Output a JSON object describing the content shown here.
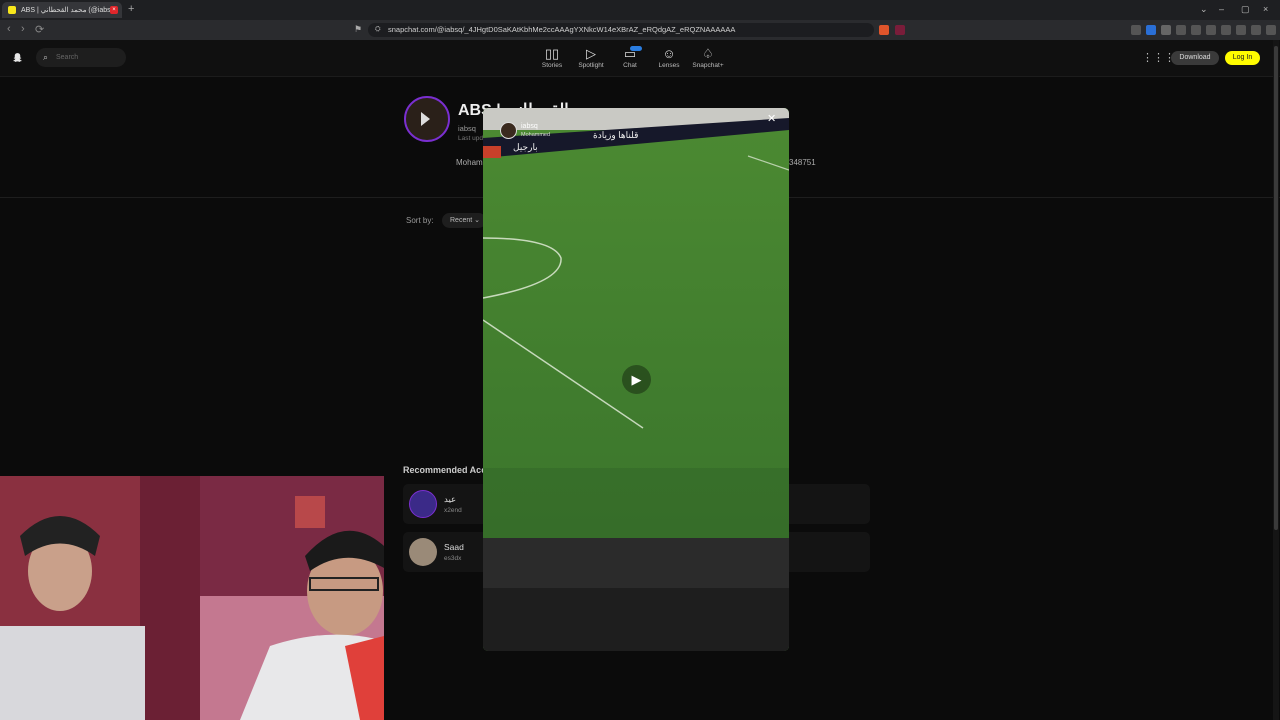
{
  "browser": {
    "tab_title": "ABS | محمد القحطاني (@iabsq",
    "tab_close": "×",
    "new_tab": "+",
    "back": "‹",
    "forward": "›",
    "reload": "⟳",
    "url": "snapchat.com/@iabsq/_4JHgtD0SaKAtKbhMe2ccAAAgYXNkcW14eXBrAZ_eRQdgAZ_eRQZNAAAAAA",
    "minimize": "–",
    "maximize": "▢",
    "close": "×",
    "more": "⌄"
  },
  "snap": {
    "search_placeholder": "Search",
    "nav": [
      {
        "label": "Stories",
        "icon": "stories-icon"
      },
      {
        "label": "Spotlight",
        "icon": "spotlight-icon"
      },
      {
        "label": "Chat",
        "icon": "chat-icon"
      },
      {
        "label": "Lenses",
        "icon": "lenses-icon"
      },
      {
        "label": "Snapchat+",
        "icon": "snapchat-plus-icon"
      }
    ],
    "download_label": "Download",
    "login_label": "Log In"
  },
  "profile": {
    "name": "ABS | القحطاني",
    "username": "iabsq",
    "updated": "Last updated",
    "bio_start": "Mohamm",
    "bio_end": "348751",
    "sort_by": "Sort by:",
    "sort_value": "Recent ⌄"
  },
  "recommended": {
    "title": "Recommended Acc",
    "accounts": [
      {
        "name": "عيد",
        "username": "x2end"
      },
      {
        "name": "Saad",
        "username": "es3dx"
      }
    ]
  },
  "video": {
    "poster_name": "iabsq",
    "poster_sub": "Mohammed",
    "close": "✕",
    "play": "▶",
    "banner_text_1": "قلناها وزيادة",
    "banner_text_2": "بارجيل"
  },
  "colors": {
    "accent_yellow": "#fffc00",
    "avatar_ring": "#7a2fd0",
    "pitch": "#3e7a2c"
  }
}
